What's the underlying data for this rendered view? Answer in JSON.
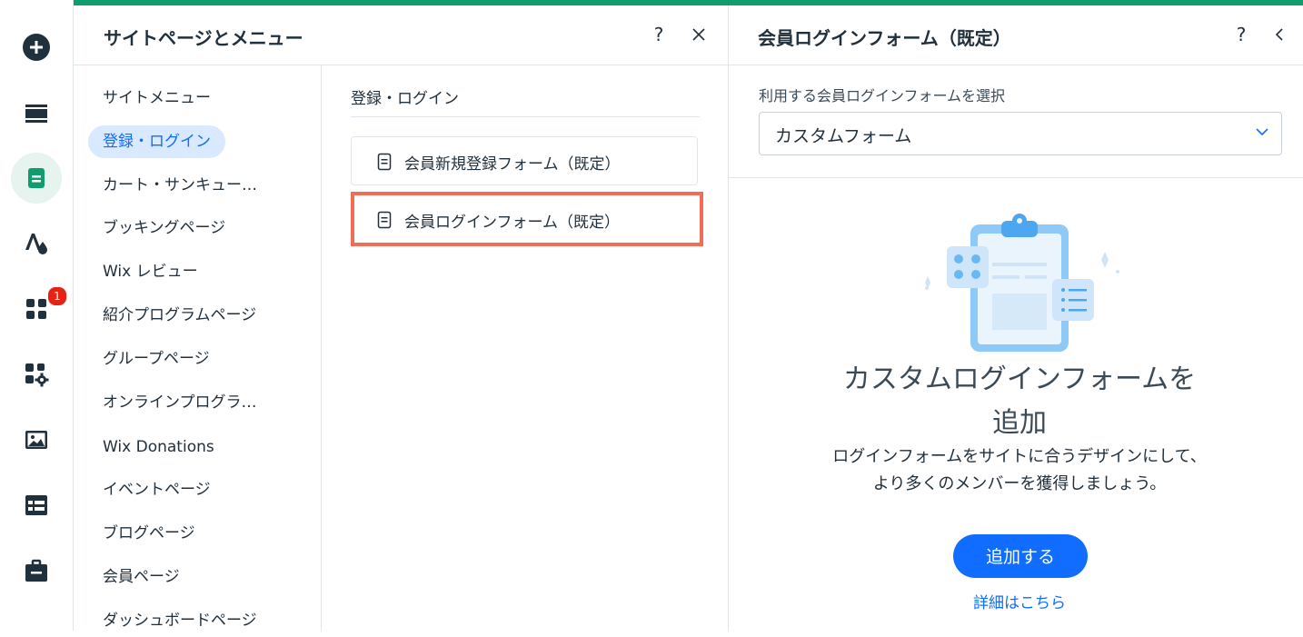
{
  "rail": {
    "items": [
      {
        "icon": "add-icon"
      },
      {
        "icon": "layout-icon"
      },
      {
        "icon": "pages-icon",
        "active": true
      },
      {
        "icon": "design-icon"
      },
      {
        "icon": "apps-icon",
        "badge": "1"
      },
      {
        "icon": "business-apps-icon"
      },
      {
        "icon": "media-icon"
      },
      {
        "icon": "cms-icon"
      },
      {
        "icon": "portfolio-icon"
      }
    ]
  },
  "panel_pages": {
    "title": "サイトページとメニュー",
    "help": "?",
    "close": "×",
    "menu_items": [
      {
        "label": "サイトメニュー"
      },
      {
        "label": "登録・ログイン",
        "selected": true
      },
      {
        "label": "カート・サンキュー…"
      },
      {
        "label": "ブッキングページ"
      },
      {
        "label": "Wix レビュー"
      },
      {
        "label": "紹介プログラムページ"
      },
      {
        "label": "グループページ"
      },
      {
        "label": "オンラインプログラ…"
      },
      {
        "label": "Wix Donations"
      },
      {
        "label": "イベントページ"
      },
      {
        "label": "ブログページ"
      },
      {
        "label": "会員ページ"
      },
      {
        "label": "ダッシュボードページ"
      }
    ],
    "section_title": "登録・ログイン",
    "pages": [
      {
        "label": "会員新規登録フォーム（既定）"
      },
      {
        "label": "会員ログインフォーム（既定）",
        "highlighted": true
      }
    ]
  },
  "panel_settings": {
    "title": "会員ログインフォーム（既定）",
    "help": "?",
    "back": "‹",
    "field_label": "利用する会員ログインフォームを選択",
    "dropdown_value": "カスタムフォーム",
    "empty_title_line1": "カスタムログインフォームを",
    "empty_title_line2": "追加",
    "empty_desc": "ログインフォームをサイトに合うデザインにして、より多くのメンバーを獲得しましょう。",
    "add_button": "追加する",
    "learn_more": "詳細はこちら"
  },
  "colors": {
    "accent": "#116dff",
    "green": "#0f9d6e",
    "highlight": "#f06e55",
    "badge": "#e62214"
  }
}
